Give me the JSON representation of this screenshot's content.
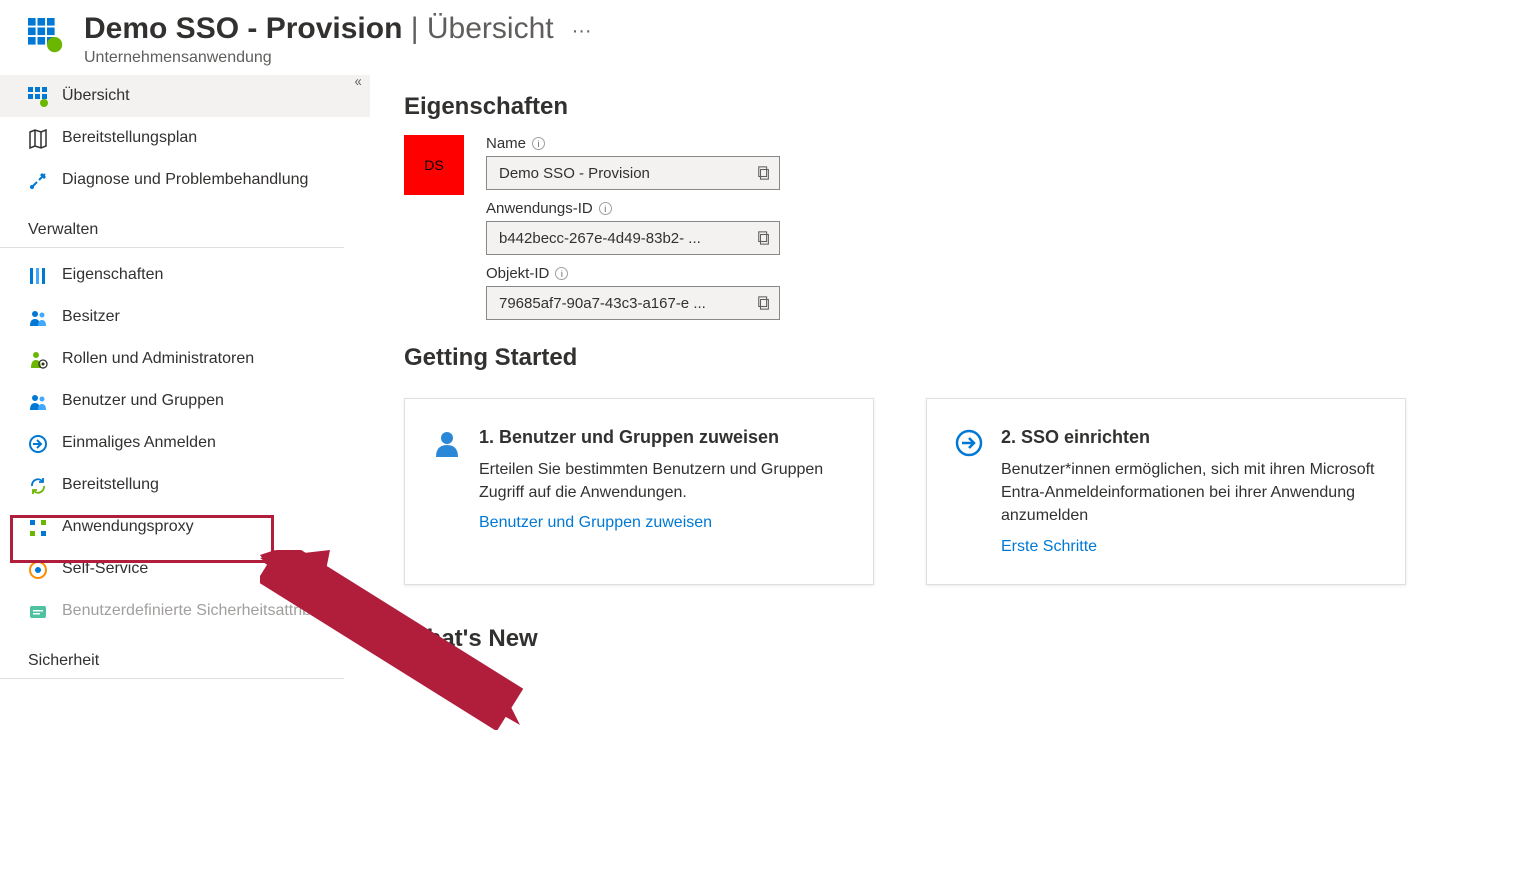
{
  "header": {
    "title_main": "Demo SSO - Provision",
    "title_separator": " | ",
    "title_sub": "Übersicht",
    "subtitle": "Unternehmensanwendung"
  },
  "sidebar": {
    "collapse_glyph": "«",
    "items_top": [
      {
        "label": "Übersicht"
      },
      {
        "label": "Bereitstellungsplan"
      },
      {
        "label": "Diagnose und Problembehandlung"
      }
    ],
    "section_verwalten": "Verwalten",
    "items_verwalten": [
      {
        "label": "Eigenschaften"
      },
      {
        "label": "Besitzer"
      },
      {
        "label": "Rollen und Administratoren"
      },
      {
        "label": "Benutzer und Gruppen"
      },
      {
        "label": "Einmaliges Anmelden"
      },
      {
        "label": "Bereitstellung"
      },
      {
        "label": "Anwendungsproxy"
      },
      {
        "label": "Self-Service"
      },
      {
        "label": "Benutzerdefinierte Sicherheitsattribute"
      }
    ],
    "section_sicherheit": "Sicherheit"
  },
  "content": {
    "eigenschaften_heading": "Eigenschaften",
    "tile_text": "DS",
    "name_label": "Name",
    "name_value": "Demo SSO - Provision",
    "appid_label": "Anwendungs-ID",
    "appid_value": "b442becc-267e-4d49-83b2- ...",
    "objid_label": "Objekt-ID",
    "objid_value": "79685af7-90a7-43c3-a167-e ...",
    "getting_started_heading": "Getting Started",
    "card1_title": "1. Benutzer und Gruppen zuweisen",
    "card1_desc": "Erteilen Sie bestimmten Benutzern und Gruppen Zugriff auf die Anwendungen.",
    "card1_link": "Benutzer und Gruppen zuweisen",
    "card2_title": "2. SSO einrichten",
    "card2_desc": "Benutzer*innen ermöglichen, sich mit ihren Microsoft Entra-Anmeldeinformationen bei ihrer Anwendung anzumelden",
    "card2_link": "Erste Schritte",
    "whats_new_heading": "What's New"
  }
}
